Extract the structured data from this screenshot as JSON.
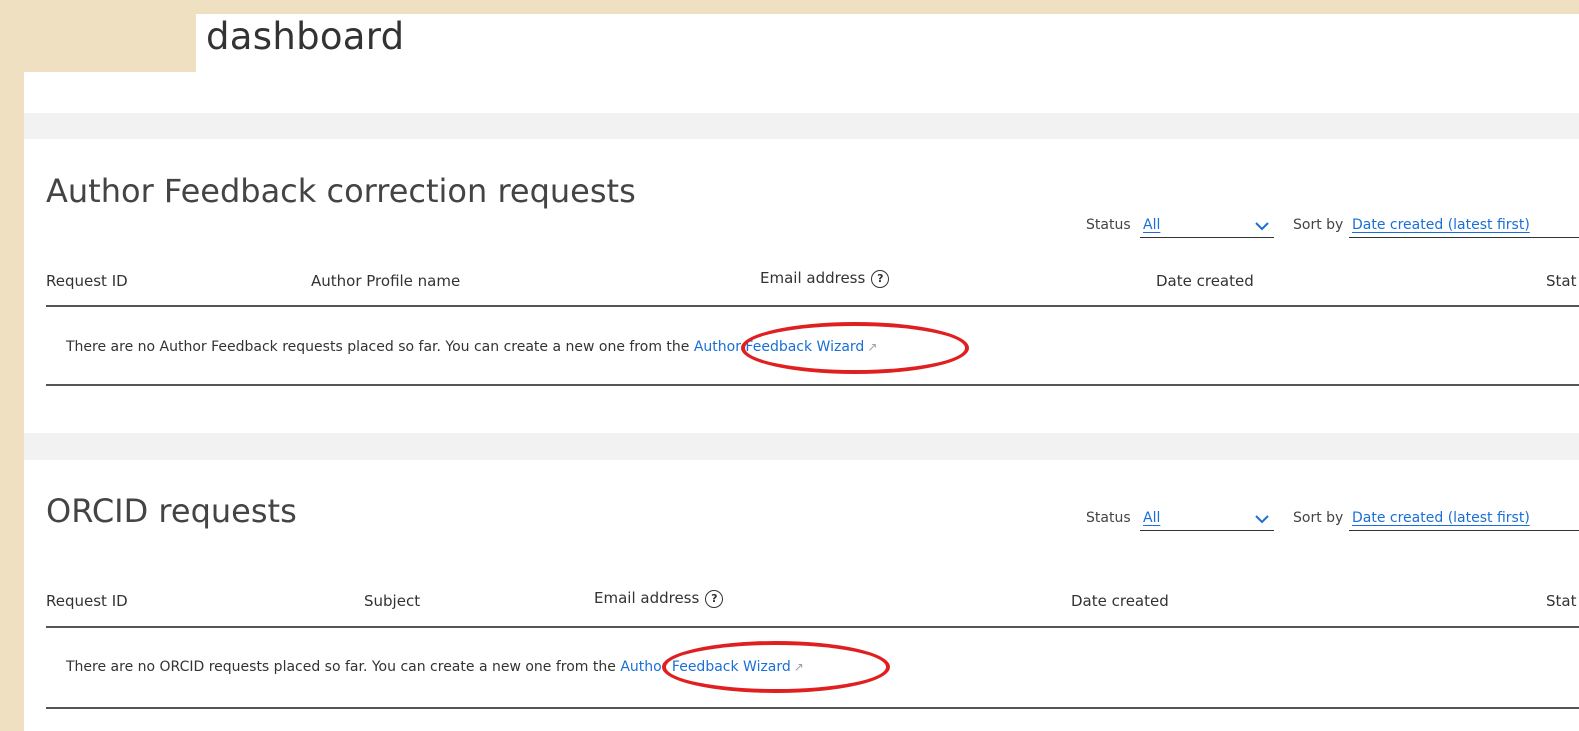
{
  "page": {
    "title": "dashboard"
  },
  "sections": [
    {
      "title": "Author Feedback correction requests",
      "status_label": "Status",
      "status_value": "All",
      "sort_label": "Sort by",
      "sort_value": "Date created (latest first)",
      "columns": [
        "Request ID",
        "Author Profile name",
        "Email address",
        "Date created",
        "Stat"
      ],
      "empty_text": "There are no Author Feedback requests placed so far. You can create a new one from the",
      "link_text": "Author Feedback Wizard"
    },
    {
      "title": "ORCID requests",
      "status_label": "Status",
      "status_value": "All",
      "sort_label": "Sort by",
      "sort_value": "Date created (latest first)",
      "columns": [
        "Request ID",
        "Subject",
        "Email address",
        "Date created",
        "Stat"
      ],
      "empty_text": "There are no ORCID requests placed so far. You can create a new one from the",
      "link_text": "Author Feedback Wizard"
    }
  ],
  "icons": {
    "help": "question-circle-icon",
    "chevron": "chevron-down-icon",
    "external": "external-link-icon"
  },
  "colors": {
    "link": "#1a6fd6",
    "highlight": "#e02020",
    "background": "#f0e0c2"
  }
}
